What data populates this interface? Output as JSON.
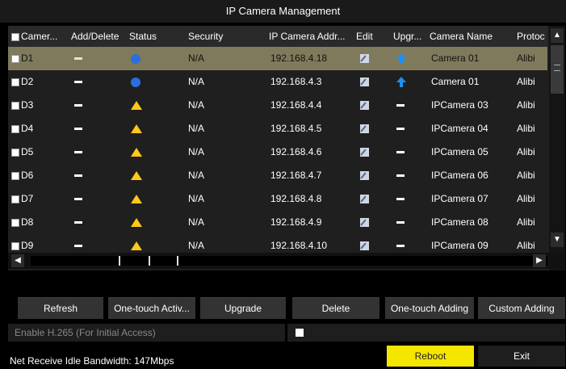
{
  "window": {
    "title": "IP Camera Management"
  },
  "table": {
    "headers": {
      "camera": "Camer...",
      "add_delete": "Add/Delete",
      "status": "Status",
      "security": "Security",
      "ip": "IP Camera Addr...",
      "edit": "Edit",
      "upgrade": "Upgr...",
      "name": "Camera Name",
      "protocol": "Protoc"
    },
    "rows": [
      {
        "id": "D1",
        "status": "online",
        "security": "N/A",
        "ip": "192.168.4.18",
        "upgrade": "arrow",
        "name": "Camera 01",
        "protocol": "Alibi"
      },
      {
        "id": "D2",
        "status": "online",
        "security": "N/A",
        "ip": "192.168.4.3",
        "upgrade": "arrow",
        "name": "Camera 01",
        "protocol": "Alibi"
      },
      {
        "id": "D3",
        "status": "warning",
        "security": "N/A",
        "ip": "192.168.4.4",
        "upgrade": "none",
        "name": "IPCamera 03",
        "protocol": "Alibi"
      },
      {
        "id": "D4",
        "status": "warning",
        "security": "N/A",
        "ip": "192.168.4.5",
        "upgrade": "none",
        "name": "IPCamera 04",
        "protocol": "Alibi"
      },
      {
        "id": "D5",
        "status": "warning",
        "security": "N/A",
        "ip": "192.168.4.6",
        "upgrade": "none",
        "name": "IPCamera 05",
        "protocol": "Alibi"
      },
      {
        "id": "D6",
        "status": "warning",
        "security": "N/A",
        "ip": "192.168.4.7",
        "upgrade": "none",
        "name": "IPCamera 06",
        "protocol": "Alibi"
      },
      {
        "id": "D7",
        "status": "warning",
        "security": "N/A",
        "ip": "192.168.4.8",
        "upgrade": "none",
        "name": "IPCamera 07",
        "protocol": "Alibi"
      },
      {
        "id": "D8",
        "status": "warning",
        "security": "N/A",
        "ip": "192.168.4.9",
        "upgrade": "none",
        "name": "IPCamera 08",
        "protocol": "Alibi"
      },
      {
        "id": "D9",
        "status": "warning",
        "security": "N/A",
        "ip": "192.168.4.10",
        "upgrade": "none",
        "name": "IPCamera 09",
        "protocol": "Alibi"
      }
    ]
  },
  "buttons": {
    "refresh": "Refresh",
    "one_touch_activate": "One-touch Activ...",
    "upgrade": "Upgrade",
    "delete": "Delete",
    "one_touch_adding": "One-touch Adding",
    "custom_adding": "Custom Adding"
  },
  "options": {
    "h265_label": "Enable H.265 (For Initial Access)"
  },
  "footer": {
    "bandwidth": "Net Receive Idle Bandwidth: 147Mbps",
    "reboot": "Reboot",
    "exit": "Exit"
  },
  "colors": {
    "selected_row": "#7f7a5b",
    "online": "#2a6ede",
    "warning": "#ffc81a",
    "reboot": "#f5e600"
  }
}
